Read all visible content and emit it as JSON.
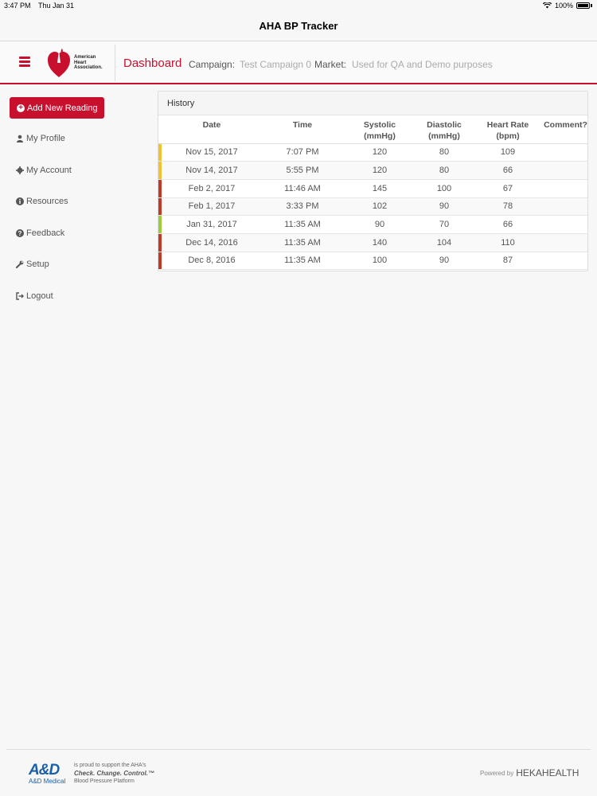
{
  "status_bar": {
    "time": "3:47 PM",
    "date": "Thu Jan 31",
    "battery": "100%"
  },
  "nav": {
    "title": "AHA BP Tracker"
  },
  "header": {
    "logo_text_1": "American",
    "logo_text_2": "Heart",
    "logo_text_3": "Association.",
    "page_title": "Dashboard",
    "campaign_label": "Campaign:",
    "campaign_value": "Test Campaign 0",
    "market_label": "Market:",
    "market_value": "Used for QA and Demo purposes",
    "accent_color": "#c8102e"
  },
  "sidebar": {
    "add_button": "Add New Reading",
    "items": [
      {
        "label": "My Profile",
        "icon": "user-icon"
      },
      {
        "label": "My Account",
        "icon": "gear-icon"
      },
      {
        "label": "Resources",
        "icon": "info-icon"
      },
      {
        "label": "Feedback",
        "icon": "question-icon"
      },
      {
        "label": "Setup",
        "icon": "wrench-icon"
      },
      {
        "label": "Logout",
        "icon": "logout-icon"
      }
    ]
  },
  "history": {
    "title": "History",
    "columns": [
      {
        "line1": "Date",
        "line2": ""
      },
      {
        "line1": "Time",
        "line2": ""
      },
      {
        "line1": "Systolic",
        "line2": "(mmHg)"
      },
      {
        "line1": "Diastolic",
        "line2": "(mmHg)"
      },
      {
        "line1": "Heart Rate",
        "line2": "(bpm)"
      },
      {
        "line1": "Comment?",
        "line2": ""
      }
    ],
    "rows": [
      {
        "date": "Nov 15, 2017",
        "time": "7:07 PM",
        "systolic": "120",
        "diastolic": "80",
        "heart_rate": "109",
        "comment": "",
        "flag_color": "#f2c12e"
      },
      {
        "date": "Nov 14, 2017",
        "time": "5:55 PM",
        "systolic": "120",
        "diastolic": "80",
        "heart_rate": "66",
        "comment": "",
        "flag_color": "#f2c12e"
      },
      {
        "date": "Feb 2, 2017",
        "time": "11:46 AM",
        "systolic": "145",
        "diastolic": "100",
        "heart_rate": "67",
        "comment": "",
        "flag_color": "#c0392b"
      },
      {
        "date": "Feb 1, 2017",
        "time": "3:33 PM",
        "systolic": "102",
        "diastolic": "90",
        "heart_rate": "78",
        "comment": "",
        "flag_color": "#c0392b"
      },
      {
        "date": "Jan 31, 2017",
        "time": "11:35 AM",
        "systolic": "90",
        "diastolic": "70",
        "heart_rate": "66",
        "comment": "",
        "flag_color": "#9ccc3c"
      },
      {
        "date": "Dec 14, 2016",
        "time": "11:35 AM",
        "systolic": "140",
        "diastolic": "104",
        "heart_rate": "110",
        "comment": "",
        "flag_color": "#c0392b"
      },
      {
        "date": "Dec 8, 2016",
        "time": "11:35 AM",
        "systolic": "100",
        "diastolic": "90",
        "heart_rate": "87",
        "comment": "",
        "flag_color": "#c0392b"
      }
    ]
  },
  "footer": {
    "and_brand": "A&D",
    "and_sub": "A&D Medical",
    "support_line1": "is proud to support the AHA's",
    "support_line2": "Check. Change. Control.™",
    "support_line3": "Blood Pressure Platform",
    "powered_by": "Powered by",
    "hekahealth": "HEKAHEALTH"
  }
}
